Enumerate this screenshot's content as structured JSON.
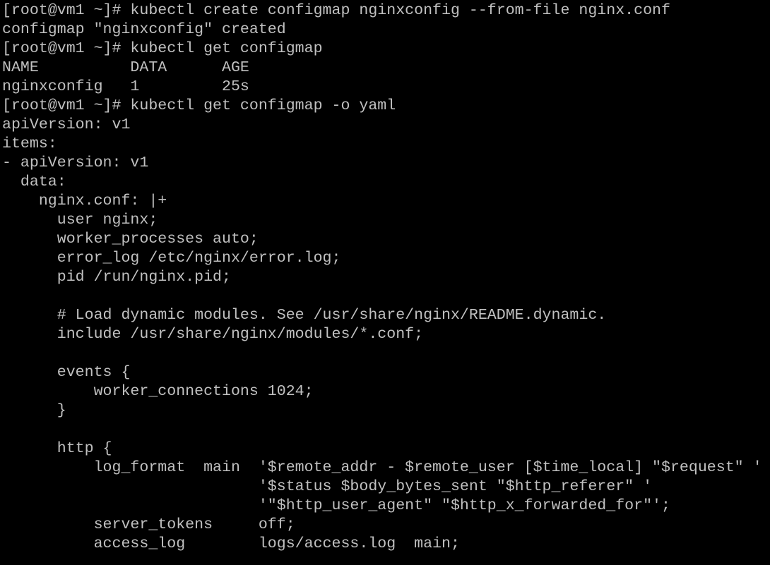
{
  "terminal": {
    "text_color": "#c0c0c0",
    "background_color": "#000000",
    "lines": [
      "[root@vm1 ~]# kubectl create configmap nginxconfig --from-file nginx.conf",
      "configmap \"nginxconfig\" created",
      "[root@vm1 ~]# kubectl get configmap",
      "NAME          DATA      AGE",
      "nginxconfig   1         25s",
      "[root@vm1 ~]# kubectl get configmap -o yaml",
      "apiVersion: v1",
      "items:",
      "- apiVersion: v1",
      "  data:",
      "    nginx.conf: |+",
      "      user nginx;",
      "      worker_processes auto;",
      "      error_log /etc/nginx/error.log;",
      "      pid /run/nginx.pid;",
      "",
      "      # Load dynamic modules. See /usr/share/nginx/README.dynamic.",
      "      include /usr/share/nginx/modules/*.conf;",
      "",
      "      events {",
      "          worker_connections 1024;",
      "      }",
      "",
      "      http {",
      "          log_format  main  '$remote_addr - $remote_user [$time_local] \"$request\" '",
      "                            '$status $body_bytes_sent \"$http_referer\" '",
      "                            '\"$http_user_agent\" \"$http_x_forwarded_for\"';",
      "          server_tokens     off;",
      "          access_log        logs/access.log  main;"
    ]
  }
}
